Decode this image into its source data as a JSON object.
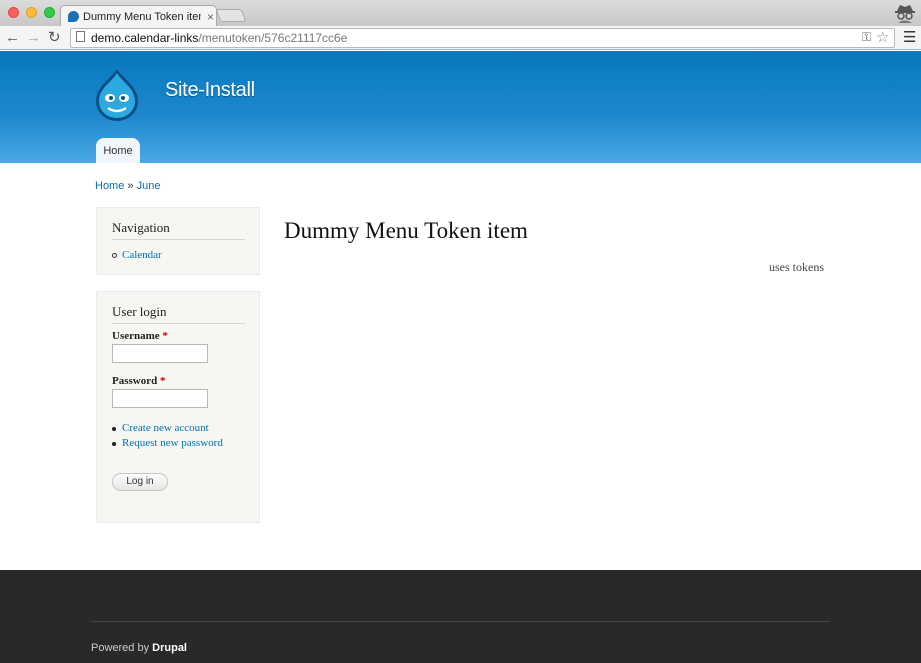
{
  "browser": {
    "tab_title": "Dummy Menu Token item",
    "tab_close": "×",
    "url_host": "demo.calendar-links",
    "url_path": "/menutoken/576c21117cc6e",
    "back": "←",
    "forward": "→",
    "reload": "↻",
    "key": "⚿",
    "star": "☆",
    "menu": "☰"
  },
  "site": {
    "name": "Site-Install",
    "nav_home": "Home"
  },
  "breadcrumb": {
    "home": "Home",
    "sep": " » ",
    "current": "June"
  },
  "sidebar": {
    "navigation": {
      "title": "Navigation",
      "items": [
        {
          "label": "Calendar"
        }
      ]
    },
    "login": {
      "title": "User login",
      "username_label": "Username",
      "password_label": "Password",
      "required_mark": "*",
      "username_value": "",
      "password_value": "",
      "links": [
        {
          "label": "Create new account"
        },
        {
          "label": "Request new password"
        }
      ],
      "submit": "Log in"
    }
  },
  "main": {
    "title": "Dummy Menu Token item",
    "body": "uses tokens"
  },
  "footer": {
    "powered_prefix": "Powered by ",
    "powered_link": "Drupal"
  },
  "colors": {
    "header_top": "#0779bf",
    "header_bottom": "#48a9e4",
    "link": "#0071b3",
    "footer_bg": "#292929"
  }
}
